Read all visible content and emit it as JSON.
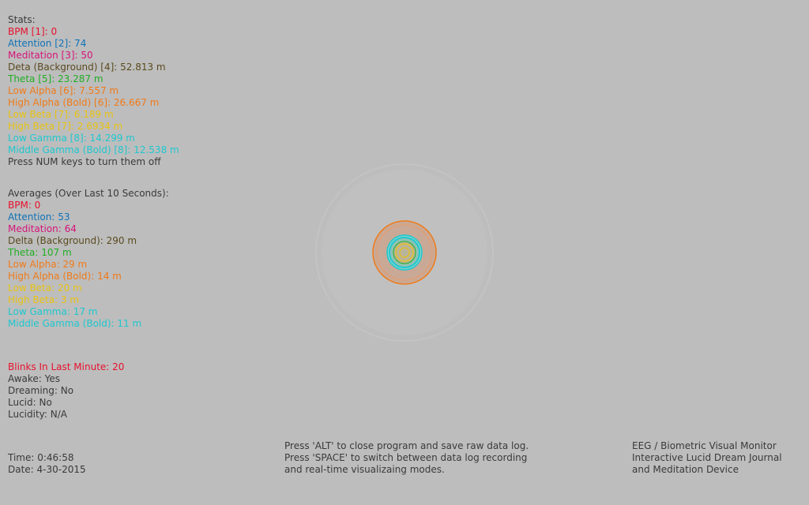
{
  "stats": {
    "heading": "Stats:",
    "lines": [
      {
        "text": "BPM [1]: 0",
        "color": "#e8102c"
      },
      {
        "text": "Attention [2]: 74",
        "color": "#0e72b8"
      },
      {
        "text": "Meditation [3]: 50",
        "color": "#d6147a"
      },
      {
        "text": "Deta (Background) [4]: 52.813 m",
        "color": "#5a4a1e"
      },
      {
        "text": "Theta [5]: 23.287 m",
        "color": "#1fae22"
      },
      {
        "text": "Low Alpha [6]: 7.557 m",
        "color": "#f07a18"
      },
      {
        "text": "High Alpha (Bold) [6]: 26.667 m",
        "color": "#f07a18"
      },
      {
        "text": "Low Beta [7]: 6.189 m",
        "color": "#e8c210"
      },
      {
        "text": "High Beta [7]: 2.6934 m",
        "color": "#e8c210"
      },
      {
        "text": "Low Gamma [8]: 14.299 m",
        "color": "#1ec8cf"
      },
      {
        "text": "Middle Gamma (Bold) [8]: 12.538 m",
        "color": "#1ec8cf"
      }
    ],
    "footer": "Press NUM keys to turn them off"
  },
  "averages": {
    "heading": "Averages (Over Last 10 Seconds):",
    "lines": [
      {
        "text": "BPM: 0",
        "color": "#e8102c"
      },
      {
        "text": "Attention: 53",
        "color": "#0e72b8"
      },
      {
        "text": "Meditation: 64",
        "color": "#d6147a"
      },
      {
        "text": "Delta (Background):  290 m",
        "color": "#5a4a1e"
      },
      {
        "text": "Theta: 107 m",
        "color": "#1fae22"
      },
      {
        "text": "Low Alpha: 29 m",
        "color": "#f07a18"
      },
      {
        "text": "High Alpha (Bold): 14 m",
        "color": "#f07a18"
      },
      {
        "text": "Low Beta: 20 m",
        "color": "#e8c210"
      },
      {
        "text": "High Beta: 3 m",
        "color": "#e8c210"
      },
      {
        "text": "Low Gamma: 17 m",
        "color": "#1ec8cf"
      },
      {
        "text": "Middle Gamma (Bold): 11 m",
        "color": "#1ec8cf"
      }
    ]
  },
  "status": {
    "blinks": "Blinks In Last Minute: 20",
    "blinks_color": "#e8102c",
    "awake": "Awake: Yes",
    "dreaming": "Dreaming: No",
    "lucid": "Lucid: No",
    "lucidity": "Lucidity: N/A"
  },
  "datetime": {
    "time": "Time: 0:46:58",
    "date": "Date: 4-30-2015"
  },
  "help": {
    "line1": "Press 'ALT' to close program and save raw data log.",
    "line2": "Press 'SPACE' to switch between data log recording",
    "line3": "and real-time visualizaing modes."
  },
  "about": {
    "line1": "EEG / Biometric Visual Monitor",
    "line2": "Interactive Lucid Dream Journal",
    "line3": "and Meditation Device"
  },
  "visualization": {
    "colors": {
      "halo": "#c4c4c4",
      "alpha": "#f07a18",
      "gamma": "#1ec8cf",
      "theta": "#1fae22",
      "beta": "#e8c210"
    }
  }
}
